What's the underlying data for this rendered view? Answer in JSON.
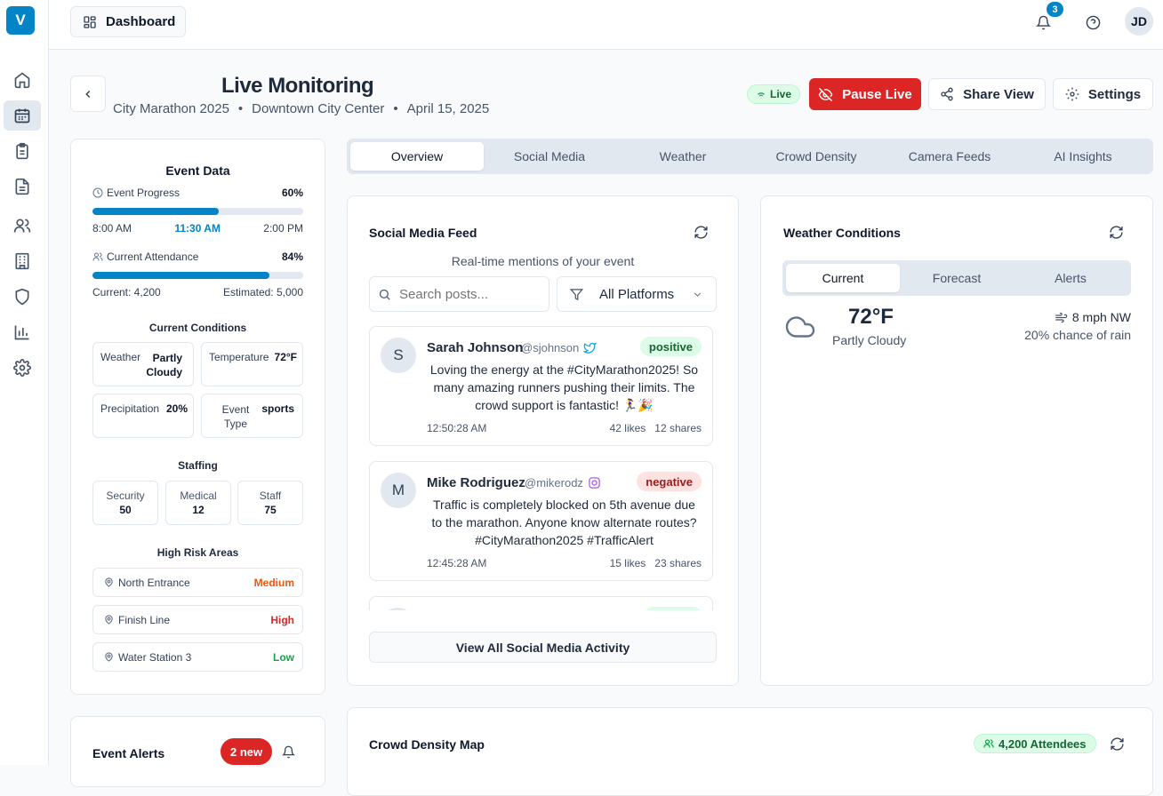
{
  "app": {
    "logo": "V"
  },
  "sidebar": {
    "icons": [
      "home-icon",
      "calendar-icon",
      "clipboard-icon",
      "document-icon",
      "users-icon",
      "building-icon",
      "shield-icon",
      "chart-icon",
      "settings-icon"
    ],
    "active": "calendar-icon"
  },
  "topbar": {
    "dashboard_label": "Dashboard",
    "notification_count": "3",
    "user_initials": "JD"
  },
  "header": {
    "title": "Live Monitoring",
    "event_name": "City Marathon 2025",
    "location": "Downtown City Center",
    "date": "April 15, 2025",
    "separator": "•",
    "live_label": "Live",
    "pause_label": "Pause Live",
    "share_label": "Share View",
    "settings_label": "Settings"
  },
  "event_data": {
    "title": "Event Data",
    "progress": {
      "label": "Event Progress",
      "percent_text": "60%",
      "value": 0.6,
      "start": "8:00 AM",
      "current": "11:30 AM",
      "end": "2:00 PM"
    },
    "attendance": {
      "label": "Current Attendance",
      "percent_text": "84%",
      "value": 0.84,
      "current_text": "Current: 4,200",
      "estimated_text": "Estimated: 5,000"
    },
    "conditions": {
      "title": "Current Conditions",
      "weather_label": "Weather",
      "weather_value": "Partly Cloudy",
      "temperature_label": "Temperature",
      "temperature_value": "72°F",
      "precip_label": "Precipitation",
      "precip_value": "20%",
      "type_label": "Event Type",
      "type_value": "sports"
    },
    "staffing": {
      "title": "Staffing",
      "items": [
        {
          "label": "Security",
          "value": "50"
        },
        {
          "label": "Medical",
          "value": "12"
        },
        {
          "label": "Staff",
          "value": "75"
        }
      ]
    },
    "risk": {
      "title": "High Risk Areas",
      "items": [
        {
          "name": "North Entrance",
          "level": "Medium",
          "color": "#ea580c"
        },
        {
          "name": "Finish Line",
          "level": "High",
          "color": "#dc2626"
        },
        {
          "name": "Water Station 3",
          "level": "Low",
          "color": "#16a34a"
        }
      ]
    }
  },
  "alerts": {
    "title": "Event Alerts",
    "new_badge": "2 new"
  },
  "tabs": [
    "Overview",
    "Social Media",
    "Weather",
    "Crowd Density",
    "Camera Feeds",
    "AI Insights"
  ],
  "social": {
    "title": "Social Media Feed",
    "subtitle": "Real-time mentions of your event",
    "search_placeholder": "Search posts...",
    "filter_label": "All Platforms",
    "view_all": "View All Social Media Activity",
    "posts": [
      {
        "initial": "S",
        "name": "Sarah Johnson",
        "handle": "@sjohnson",
        "platform": "twitter-icon",
        "sentiment": "positive",
        "text": "Loving the energy at the #CityMarathon2025! So many amazing runners pushing their limits. The crowd support is fantastic! 🏃‍♀️🎉",
        "time": "12:50:28 AM",
        "likes": "42 likes",
        "shares": "12 shares"
      },
      {
        "initial": "M",
        "name": "Mike Rodriguez",
        "handle": "@mikerodz",
        "platform": "instagram-icon",
        "sentiment": "negative",
        "text": "Traffic is completely blocked on 5th avenue due to the marathon. Anyone know alternate routes? #CityMarathon2025 #TrafficAlert",
        "time": "12:45:28 AM",
        "likes": "15 likes",
        "shares": "23 shares"
      }
    ]
  },
  "weather": {
    "title": "Weather Conditions",
    "tabs": [
      "Current",
      "Forecast",
      "Alerts"
    ],
    "temp": "72°F",
    "condition": "Partly Cloudy",
    "wind": "8 mph NW",
    "rain": "20% chance of rain"
  },
  "crowd": {
    "title": "Crowd Density Map",
    "attendees": "4,200 Attendees"
  }
}
